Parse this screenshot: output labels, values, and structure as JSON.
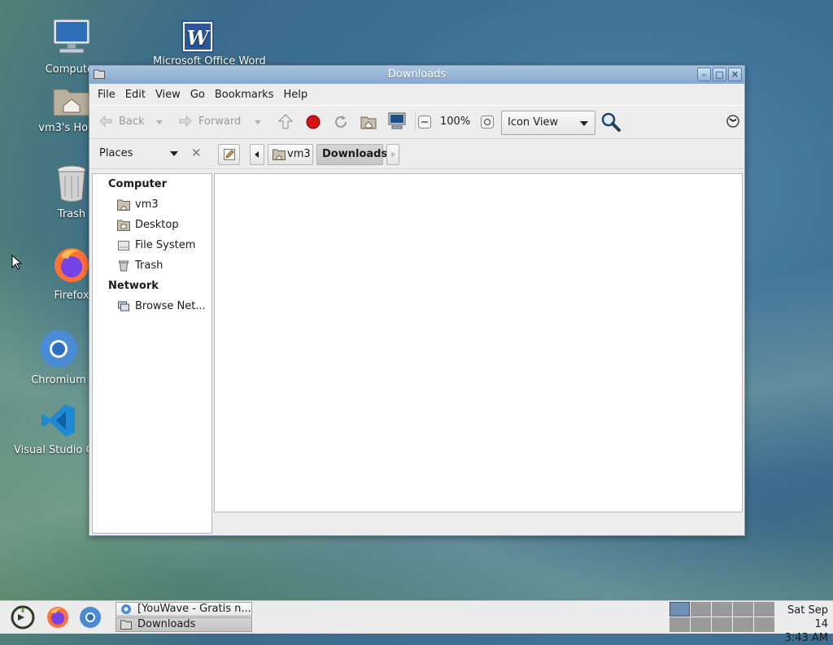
{
  "desktop": {
    "icons": [
      {
        "label": "Computer"
      },
      {
        "label": "Microsoft Office Word"
      },
      {
        "label": "vm3's Home"
      },
      {
        "label": "Trash"
      },
      {
        "label": "Firefox"
      },
      {
        "label": "Chromium"
      },
      {
        "label": "Visual Studio Code"
      }
    ]
  },
  "window": {
    "title": "Downloads",
    "menu": [
      "File",
      "Edit",
      "View",
      "Go",
      "Bookmarks",
      "Help"
    ],
    "toolbar": {
      "back_label": "Back",
      "forward_label": "Forward",
      "zoom": "100%",
      "view_mode": "Icon View"
    },
    "location": {
      "places_label": "Places",
      "crumbs": [
        "vm3",
        "Downloads"
      ]
    },
    "sidebar": {
      "computer_header": "Computer",
      "computer_items": [
        "vm3",
        "Desktop",
        "File System",
        "Trash"
      ],
      "network_header": "Network",
      "network_items": [
        "Browse Net..."
      ]
    }
  },
  "taskbar": {
    "tasks": [
      "[YouWave - Gratis n...",
      "Downloads"
    ],
    "clock_date": "Sat Sep 14",
    "clock_time": "3:43 AM"
  }
}
